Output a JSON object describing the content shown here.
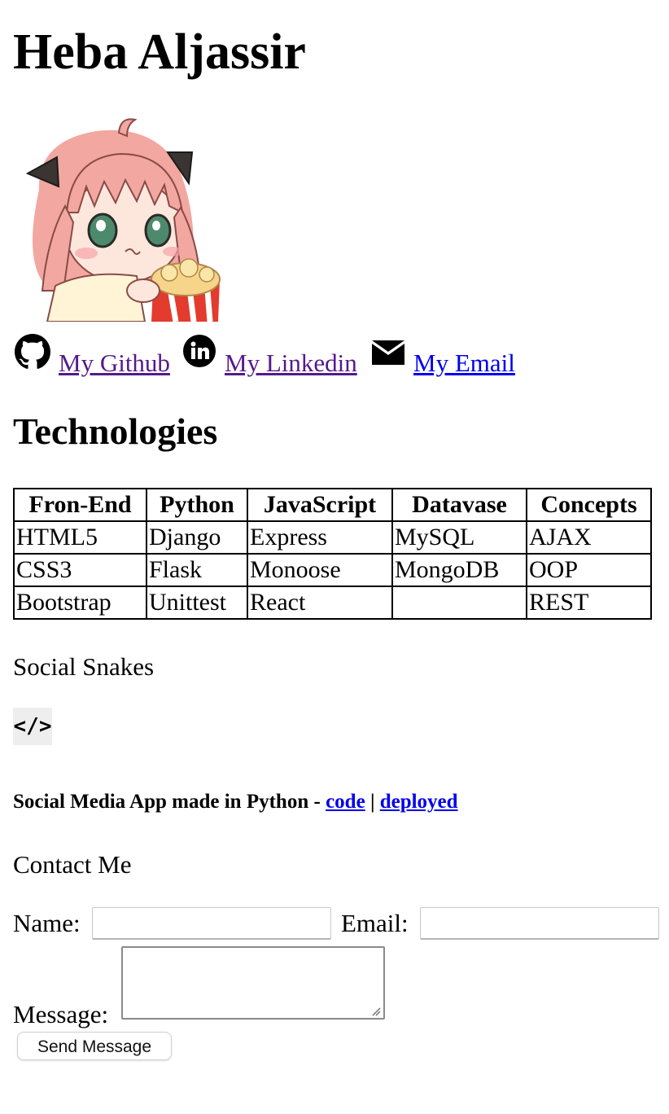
{
  "header": {
    "name": "Heba Aljassir"
  },
  "links": [
    {
      "label": "My Github",
      "icon": "github-icon",
      "state": "visited"
    },
    {
      "label": "My Linkedin",
      "icon": "linkedin-icon",
      "state": "visited"
    },
    {
      "label": "My Email",
      "icon": "mail-icon",
      "state": "unvisited"
    }
  ],
  "technologies": {
    "title": "Technologies",
    "headers": [
      "Fron-End",
      "Python",
      "JavaScript",
      "Datavase",
      "Concepts"
    ],
    "rows": [
      [
        "HTML5",
        "Django",
        "Express",
        "MySQL",
        "AJAX"
      ],
      [
        "CSS3",
        "Flask",
        "Monoose",
        "MongoDB",
        "OOP"
      ],
      [
        "Bootstrap",
        "Unittest",
        "React",
        "",
        "REST"
      ]
    ]
  },
  "project": {
    "title": "Social Snakes",
    "code_symbol": "</>",
    "description": "Social Media App made in Python - ",
    "code_link": "code",
    "separator": " | ",
    "deployed_link": "deployed"
  },
  "contact": {
    "title": "Contact Me",
    "name_label": "Name:",
    "email_label": "Email:",
    "message_label": "Message:",
    "name_value": "",
    "email_value": "",
    "message_value": "",
    "send_label": "Send Message"
  },
  "colors": {
    "link_visited": "#551a8b",
    "link_unvisited": "#0000ee",
    "code_badge_bg": "#eeeeee"
  }
}
